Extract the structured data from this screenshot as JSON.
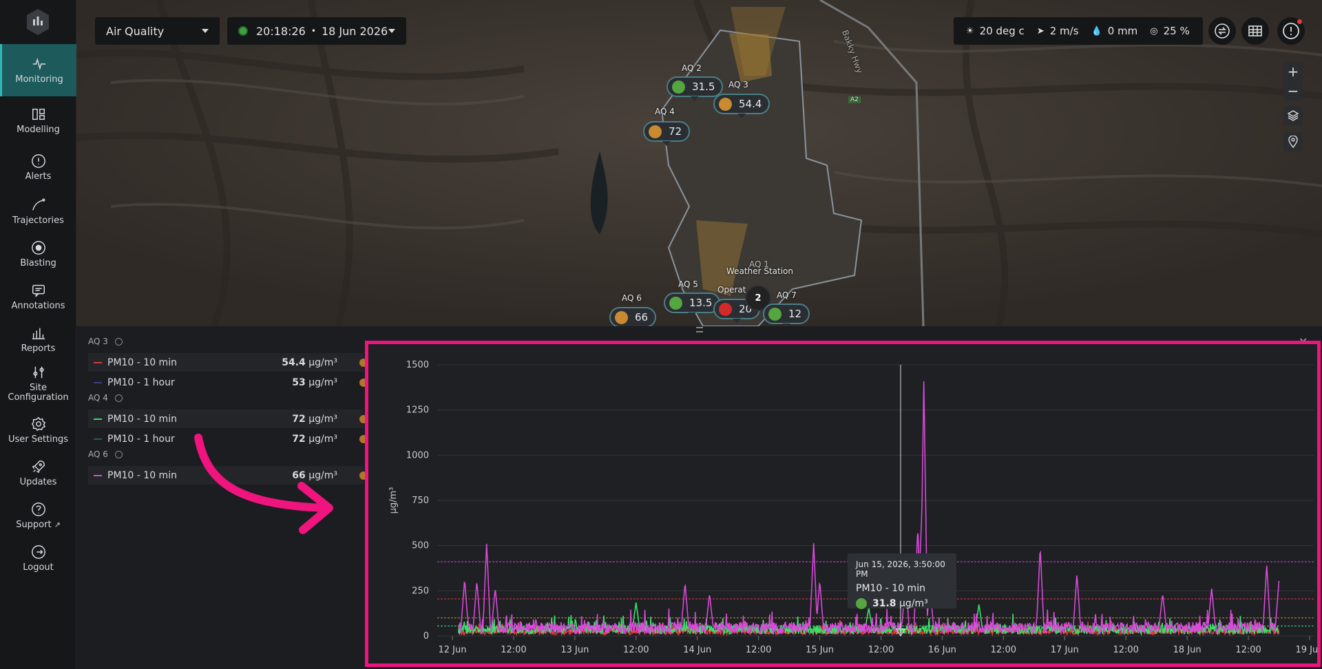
{
  "sidebar": {
    "items": [
      {
        "label": "Monitoring",
        "icon": "pulse-icon",
        "active": true
      },
      {
        "label": "Modelling",
        "icon": "modelling-icon"
      },
      {
        "label": "Alerts",
        "icon": "alert-circle-icon"
      },
      {
        "label": "Trajectories",
        "icon": "trajectory-icon"
      },
      {
        "label": "Blasting",
        "icon": "target-icon"
      },
      {
        "label": "Annotations",
        "icon": "comment-icon"
      },
      {
        "label": "Reports",
        "icon": "bar-chart-icon"
      },
      {
        "label": "Site Configuration",
        "icon": "sliders-icon"
      },
      {
        "label": "User Settings",
        "icon": "gear-icon"
      },
      {
        "label": "Updates",
        "icon": "rocket-icon"
      },
      {
        "label": "Support",
        "icon": "help-circle-icon"
      },
      {
        "label": "Logout",
        "icon": "logout-icon"
      }
    ]
  },
  "toolbar": {
    "layer_select": "Air Quality",
    "time": "20:18:26",
    "separator": "•",
    "date": "18 Jun 2026"
  },
  "weather": {
    "temp": "20 deg c",
    "wind": "2 m/s",
    "rain": "0 mm",
    "humidity": "25 %"
  },
  "map": {
    "road_label": "Bakky Hwy",
    "road_badge": "A2",
    "pins": [
      {
        "label": "AQ 2",
        "value": "31.5",
        "status": "#55a640"
      },
      {
        "label": "AQ 3",
        "value": "54.4",
        "status": "#c98a30"
      },
      {
        "label": "AQ 4",
        "value": "72",
        "status": "#c98a30"
      },
      {
        "label": "AQ 5",
        "value": "13.5",
        "status": "#55a640"
      },
      {
        "label": "AQ 6",
        "value": "66",
        "status": "#c98a30"
      },
      {
        "label": "AQ 7",
        "value": "12",
        "status": "#55a640"
      },
      {
        "label": "Operat",
        "value": "20",
        "status": "#d22a2a"
      }
    ],
    "weather_station_label": "Weather Station",
    "aq1_label": "AQ 1",
    "cluster_count": "2"
  },
  "list": {
    "groups": [
      {
        "name": "AQ 3",
        "rows": [
          {
            "label": "PM10 - 10 min",
            "value": "54.4",
            "unit": "µg/m³",
            "color": "#e03a3a"
          },
          {
            "label": "PM10 - 1 hour",
            "value": "53",
            "unit": "µg/m³",
            "color": "#3a3f88"
          }
        ]
      },
      {
        "name": "AQ 4",
        "rows": [
          {
            "label": "PM10 - 10 min",
            "value": "72",
            "unit": "µg/m³",
            "color": "#3ae06a"
          },
          {
            "label": "PM10 - 1 hour",
            "value": "72",
            "unit": "µg/m³",
            "color": "#2e5f3a"
          }
        ]
      },
      {
        "name": "AQ 6",
        "rows": [
          {
            "label": "PM10 - 10 min",
            "value": "66",
            "unit": "µg/m³",
            "color": "#d94ad9"
          }
        ]
      }
    ]
  },
  "tooltip": {
    "datetime": "Jun 15, 2026, 3:50:00 PM",
    "series": "PM10 - 10 min",
    "value": "31.8",
    "unit": "µg/m³"
  },
  "chart_data": {
    "type": "line",
    "ylabel": "µg/m³",
    "ylim": [
      0,
      1500
    ],
    "yticks": [
      0,
      250,
      500,
      750,
      1000,
      1250,
      1500
    ],
    "xticks": [
      "12 Jun",
      "12:00",
      "13 Jun",
      "12:00",
      "14 Jun",
      "12:00",
      "15 Jun",
      "12:00",
      "16 Jun",
      "12:00",
      "17 Jun",
      "12:00",
      "18 Jun",
      "12:00",
      "19 Jun"
    ],
    "x_days_start": 12,
    "x_days_end": 19,
    "grid": true,
    "thresholds": [
      {
        "value": 410,
        "color": "#d94ad9"
      },
      {
        "value": 205,
        "color": "#e03a3a"
      },
      {
        "value": 100,
        "color": "#c98a30"
      },
      {
        "value": 55,
        "color": "#3ae06a"
      }
    ],
    "series": [
      {
        "name": "AQ 6 PM10 - 10 min",
        "color": "#d94ad9",
        "spikes": [
          [
            12.1,
            270
          ],
          [
            12.2,
            260
          ],
          [
            12.28,
            470
          ],
          [
            12.35,
            220
          ],
          [
            13.9,
            250
          ],
          [
            14.1,
            190
          ],
          [
            14.95,
            470
          ],
          [
            15.0,
            260
          ],
          [
            15.7,
            280
          ],
          [
            15.8,
            560
          ],
          [
            15.85,
            1370
          ],
          [
            15.83,
            600
          ],
          [
            15.9,
            230
          ],
          [
            16.8,
            450
          ],
          [
            17.1,
            300
          ],
          [
            17.8,
            190
          ],
          [
            18.2,
            220
          ],
          [
            18.65,
            350
          ],
          [
            18.75,
            260
          ]
        ],
        "baseline": 45
      },
      {
        "name": "AQ 4 PM10 - 10 min",
        "color": "#3ae06a",
        "spikes": [
          [
            13.5,
            150
          ],
          [
            15.4,
            120
          ],
          [
            16.3,
            140
          ]
        ],
        "baseline": 35
      },
      {
        "name": "AQ 3 PM10 - 10 min",
        "color": "#e03a3a",
        "spikes": [],
        "baseline": 25
      }
    ],
    "cursor_day": 15.66
  }
}
